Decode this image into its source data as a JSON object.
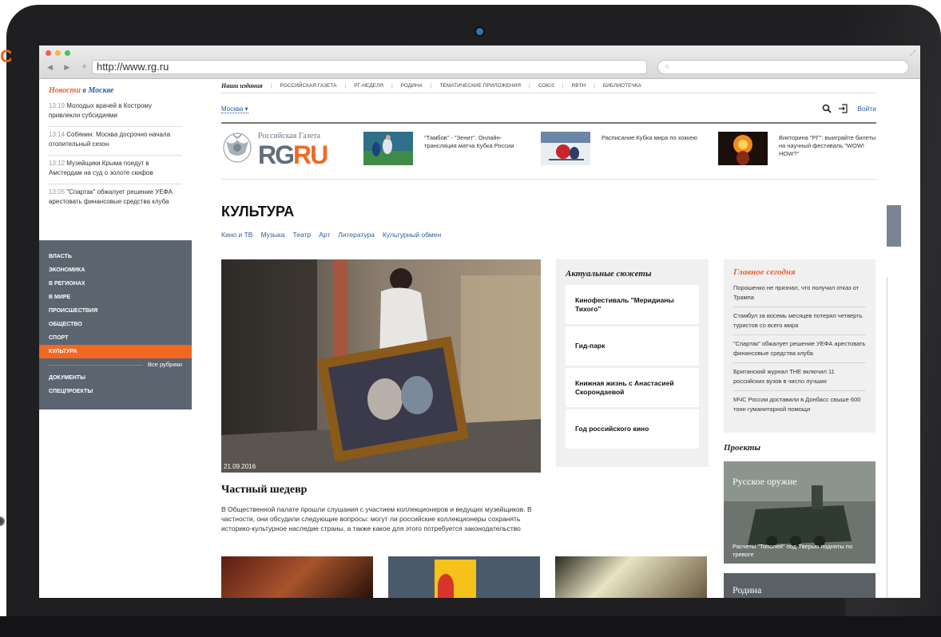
{
  "browser": {
    "url": "http://www.rg.ru"
  },
  "sidebar": {
    "heading_a": "Новости",
    "heading_b": "в Москве",
    "news": [
      {
        "time": "13:19",
        "text": "Молодых врачей в Кострому привлекли субсидиями"
      },
      {
        "time": "13:14",
        "text": "Собянин: Москва досрочно начала отопительный сезон"
      },
      {
        "time": "13:12",
        "text": "Музейщики Крыма поедут в Амстердам на суд о золоте скифов"
      },
      {
        "time": "13:05",
        "text": "\"Спартак\" обжалует решение УЕФА арестовать финансовые средства клуба"
      }
    ],
    "rubrics": [
      "ВЛАСТЬ",
      "ЭКОНОМИКА",
      "В РЕГИОНАХ",
      "В МИРЕ",
      "ПРОИСШЕСТВИЯ",
      "ОБЩЕСТВО",
      "СПОРТ",
      "КУЛЬТУРА"
    ],
    "active_rubric": "КУЛЬТУРА",
    "all_rubrics": "Все рубрики",
    "extra": [
      "ДОКУМЕНТЫ",
      "СПЕЦПРОЕКТЫ"
    ]
  },
  "header": {
    "pubs_label": "Наши издания",
    "pubs": [
      "РОССИЙСКАЯ ГАЗЕТА",
      "РГ-НЕДЕЛЯ",
      "РОДИНА",
      "ТЕМАТИЧЕСКИЕ ПРИЛОЖЕНИЯ",
      "СОЮЗ",
      "RBTH",
      "БИБЛИОТЕЧКА"
    ],
    "city": "Москва",
    "login": "Войти",
    "logo_top": "Российская Газета",
    "logo_rg": "RG",
    "logo_ru": "RU",
    "teasers": [
      "\"Тамбов\" - \"Зенит\". Онлайн-трансляция матча Кубка России",
      "Расписание Кубка мира по хоккею",
      "Викторина \"РГ\": выиграйте билеты на научный фестиваль \"WOW! HOW?\""
    ]
  },
  "main": {
    "section": "КУЛЬТУРА",
    "subnav": [
      "Кино и ТВ",
      "Музыка",
      "Театр",
      "Арт",
      "Литература",
      "Культурный обмен"
    ],
    "hero_date": "21.09.2016",
    "hero_title": "Частный шедевр",
    "hero_lead": "В Общественной палате прошли слушания с участием коллекционеров и ведущих музейщиков. В частности, они обсудили следующие вопросы: могут ли российские коллекционеры сохранять историко-культурное наследие страны, а также какое для этого потребуется законодательство"
  },
  "stories": {
    "heading": "Актуальные сюжеты",
    "items": [
      "Кинофестиваль \"Меридианы Тихого\"",
      "Гид-парк",
      "Книжная жизнь с Анастасией Скорондаевой",
      "Год российского кино"
    ]
  },
  "today": {
    "heading": "Главное сегодня",
    "items": [
      "Порошенко не признал, что получил отказ от Трампа",
      "Стамбул за восемь месяцев потерял четверть туристов со всего мира",
      "\"Спартак\" обжалует решение УЕФА арестовать финансовые средства клуба",
      "Британский журнал THE включил 11 российских вузов в число лучших",
      "МЧС России доставили в Донбасс свыше 600 тонн гуманитарной помощи"
    ]
  },
  "projects": {
    "heading": "Проекты",
    "card1_title": "Русское оружие",
    "card1_caption": "Расчеты \"Тополей\" под Тверью подняты по тревоге",
    "card2_title": "Родина"
  },
  "decor": {
    "edge_letter": "C"
  }
}
